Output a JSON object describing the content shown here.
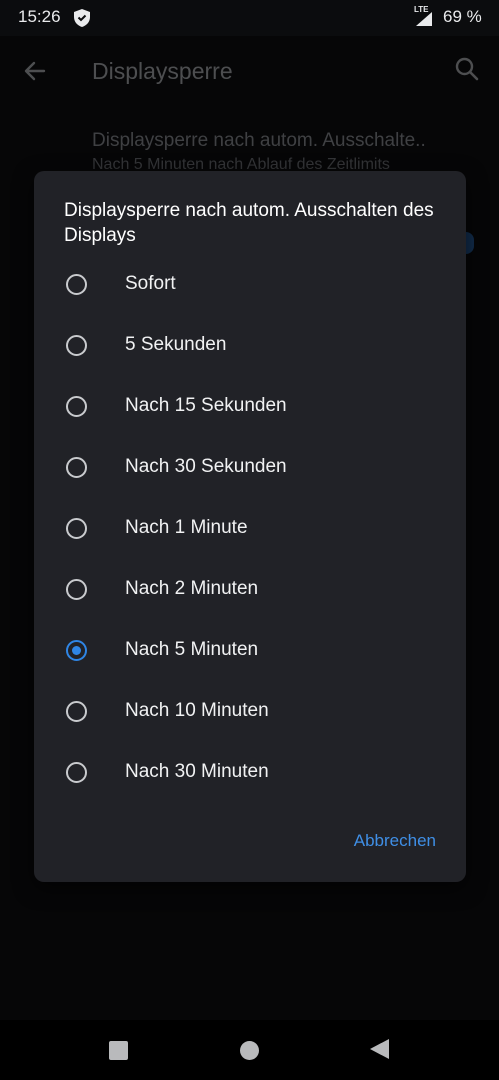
{
  "status_bar": {
    "time": "15:26",
    "network": "LTE",
    "battery": "69 %"
  },
  "app_bar": {
    "title": "Displaysperre"
  },
  "background_setting": {
    "title": "Displaysperre nach autom. Ausschalte..",
    "subtitle": "Nach 5 Minuten nach Ablauf des Zeitlimits"
  },
  "dialog": {
    "title": "Displaysperre nach autom. Ausschalten des Displays",
    "options": [
      {
        "label": "Sofort",
        "selected": false
      },
      {
        "label": "5 Sekunden",
        "selected": false
      },
      {
        "label": "Nach 15 Sekunden",
        "selected": false
      },
      {
        "label": "Nach 30 Sekunden",
        "selected": false
      },
      {
        "label": "Nach 1 Minute",
        "selected": false
      },
      {
        "label": "Nach 2 Minuten",
        "selected": false
      },
      {
        "label": "Nach 5 Minuten",
        "selected": true
      },
      {
        "label": "Nach 10 Minuten",
        "selected": false
      },
      {
        "label": "Nach 30 Minuten",
        "selected": false
      }
    ],
    "cancel_label": "Abbrechen"
  },
  "colors": {
    "accent": "#2f86e6",
    "dialog_bg": "#212227",
    "screen_bg": "#0b0c0e"
  }
}
